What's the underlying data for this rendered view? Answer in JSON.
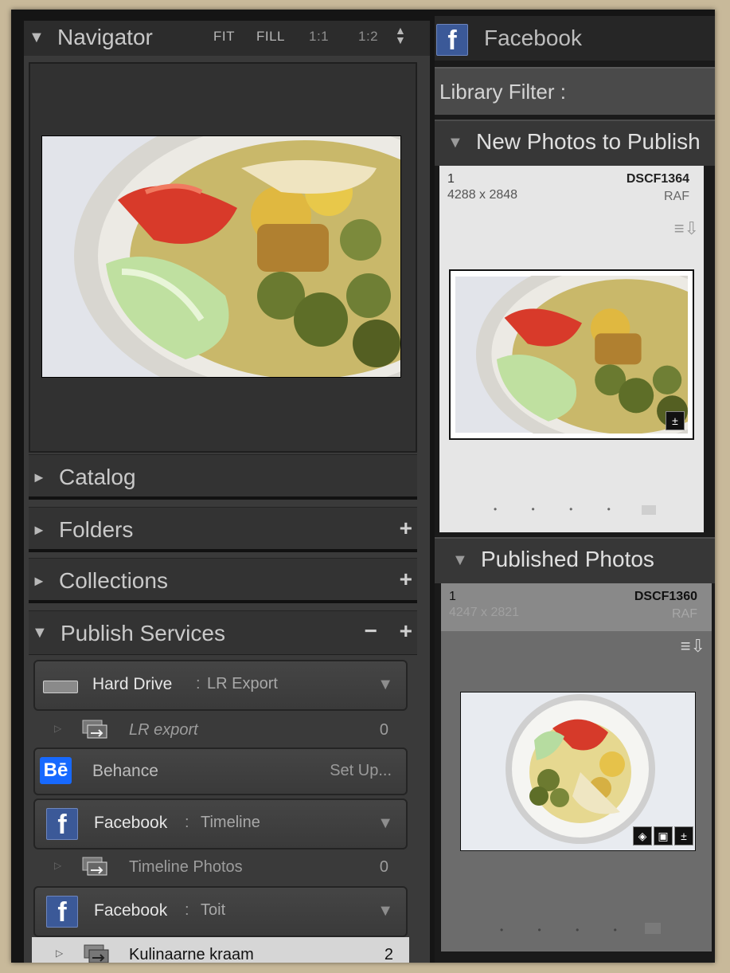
{
  "left_panel": {
    "navigator": {
      "title": "Navigator",
      "zoom": [
        "FIT",
        "FILL",
        "1:1",
        "1:2"
      ]
    },
    "panels": [
      {
        "label": "Catalog",
        "has_plus": false
      },
      {
        "label": "Folders",
        "has_plus": true
      },
      {
        "label": "Collections",
        "has_plus": true
      }
    ],
    "publish_services": {
      "title": "Publish Services",
      "minus": "−",
      "plus": "+",
      "services": [
        {
          "name": "Hard Drive",
          "sub": "LR Export",
          "icon": "hard-drive-icon",
          "collection": {
            "name": "LR export",
            "count": "0"
          }
        },
        {
          "name": "Behance",
          "action": "Set Up...",
          "icon": "behance-icon"
        },
        {
          "name": "Facebook",
          "sub": "Timeline",
          "icon": "facebook-icon",
          "collection": {
            "name": "Timeline Photos",
            "count": "0"
          }
        },
        {
          "name": "Facebook",
          "sub": "Toit",
          "icon": "facebook-icon",
          "collection": {
            "name": "Kulinaarne kraam",
            "count": "2"
          }
        }
      ]
    }
  },
  "right_panel": {
    "service_title": "Facebook",
    "library_filter": "Library Filter :",
    "new_photos": {
      "title": "New Photos to Publish",
      "photo": {
        "index": "1",
        "dimensions": "4288 x 2848",
        "filename": "DSCF1364",
        "type": "RAF"
      }
    },
    "published": {
      "title": "Published Photos",
      "photo": {
        "index": "1",
        "dimensions": "4247 x 2821",
        "filename": "DSCF1360",
        "type": "RAF"
      }
    }
  },
  "colors": {
    "panel": "#3a3a3a",
    "header": "#2c2c2c",
    "facebook_blue": "#3b5998",
    "behance_blue": "#1769ff"
  }
}
